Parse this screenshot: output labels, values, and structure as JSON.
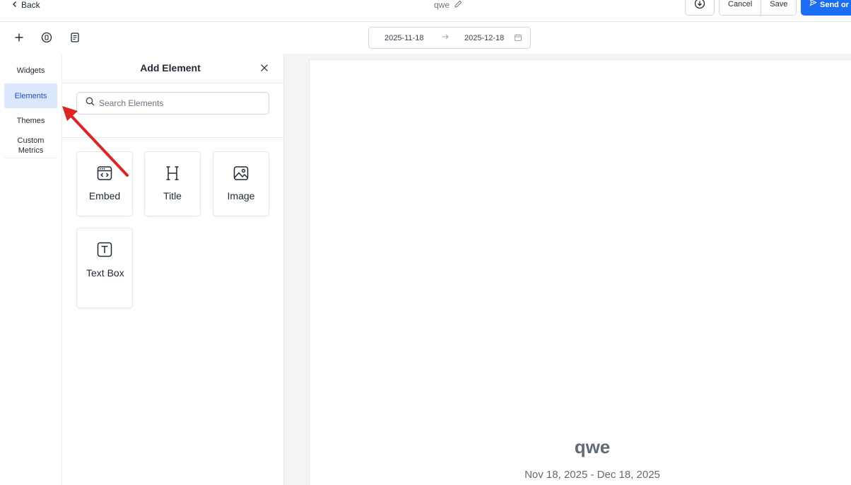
{
  "topbar": {
    "back_label": "Back",
    "doc_title": "qwe",
    "cancel_label": "Cancel",
    "save_label": "Save",
    "send_label": "Send or S"
  },
  "toolbar": {
    "date_start": "2025-11-18",
    "date_end": "2025-12-18"
  },
  "leftnav": {
    "items": [
      {
        "label": "Widgets"
      },
      {
        "label": "Elements",
        "active": true
      },
      {
        "label": "Themes"
      },
      {
        "label": "Custom Metrics"
      }
    ]
  },
  "panel": {
    "title": "Add Element",
    "search_placeholder": "Search Elements",
    "elements": [
      {
        "label": "Embed",
        "icon": "embed-icon"
      },
      {
        "label": "Title",
        "icon": "heading-icon"
      },
      {
        "label": "Image",
        "icon": "image-icon"
      },
      {
        "label": "Text Box",
        "icon": "text-box-icon"
      }
    ]
  },
  "canvas": {
    "report_title": "qwe",
    "report_dates": "Nov 18, 2025 - Dec 18, 2025"
  },
  "colors": {
    "primary": "#1a6ef5",
    "active_nav_bg": "#dbe7fd",
    "annotation_arrow": "#e02424"
  }
}
